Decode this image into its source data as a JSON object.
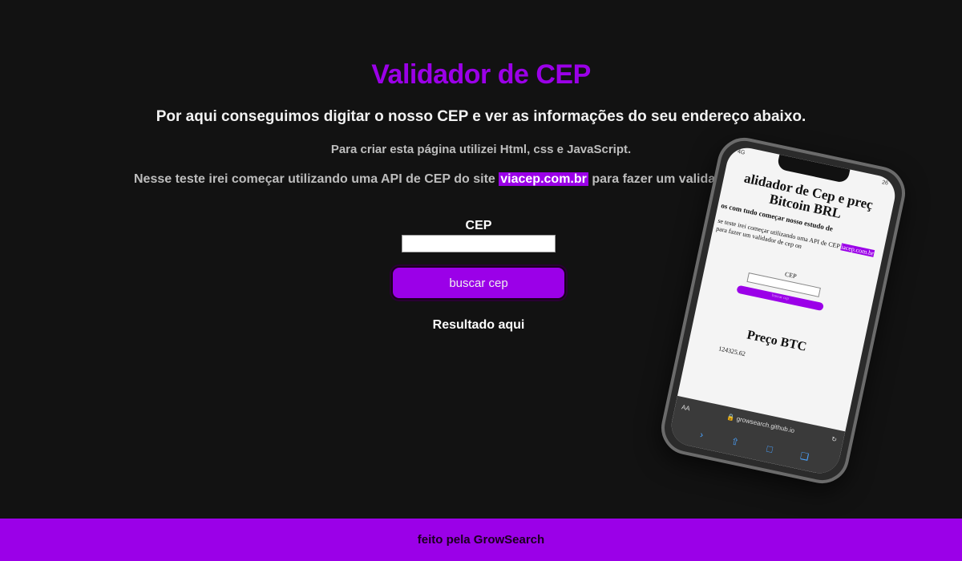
{
  "page": {
    "title": "Validador de CEP",
    "subtitle": "Por aqui conseguimos digitar o nosso CEP e ver as informações do seu endereço abaixo.",
    "desc1": "Para criar esta página utilizei Html, css e JavaScript.",
    "desc2_before": "Nesse teste irei começar utilizando uma API de CEP do site ",
    "desc2_link": "viacep.com.br",
    "desc2_after": " para fazer um validador de ce"
  },
  "form": {
    "cep_label": "CEP",
    "cep_value": "",
    "button_label": "buscar cep",
    "result_text": "Resultado aqui"
  },
  "footer": {
    "text": "feito pela GrowSearch"
  },
  "phone": {
    "status_left": "4G",
    "status_right": "26",
    "title": "alidador de Cep e preç Bitcoin BRL",
    "sub": "os com tudo começar nosso estudo de",
    "text_before": "se teste irei começar utilizando uma API de CEP ",
    "text_link": "iacep.com.br",
    "text_after": " para fazer um validador de cep on",
    "cep_label": "CEP",
    "button_label": "buscar cep",
    "btc_title": "Preço BTC",
    "btc_value": "124325.62",
    "aa_label": "AA",
    "url": "growsearch.github.io",
    "nav_icons": [
      "chevron-right-icon",
      "share-icon",
      "book-icon",
      "tabs-icon"
    ]
  },
  "colors": {
    "accent": "#9b00e8",
    "background": "#121212"
  }
}
